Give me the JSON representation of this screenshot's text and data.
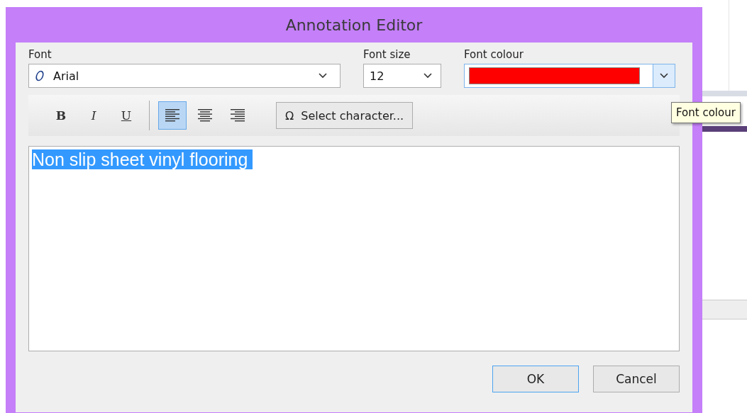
{
  "window": {
    "title": "Annotation Editor"
  },
  "font": {
    "label": "Font",
    "value": "Arial"
  },
  "font_size": {
    "label": "Font size",
    "value": "12"
  },
  "font_colour": {
    "label": "Font colour",
    "color": "#ff0000",
    "focused": true
  },
  "format_buttons": [
    {
      "kind": "bold",
      "label": "B",
      "selected": false
    },
    {
      "kind": "italic",
      "label": "I",
      "selected": false
    },
    {
      "kind": "underline",
      "label": "U",
      "selected": false
    }
  ],
  "align_buttons": [
    {
      "kind": "left",
      "selected": true
    },
    {
      "kind": "center",
      "selected": false
    },
    {
      "kind": "right",
      "selected": false
    }
  ],
  "select_character": {
    "icon": "Ω",
    "label": "Select character..."
  },
  "editor": {
    "text": "Non slip sheet vinyl flooring ",
    "selected": true
  },
  "buttons": [
    {
      "label": "OK",
      "default": true
    },
    {
      "label": "Cancel",
      "default": false
    }
  ],
  "tooltip": {
    "text": "Font colour"
  }
}
